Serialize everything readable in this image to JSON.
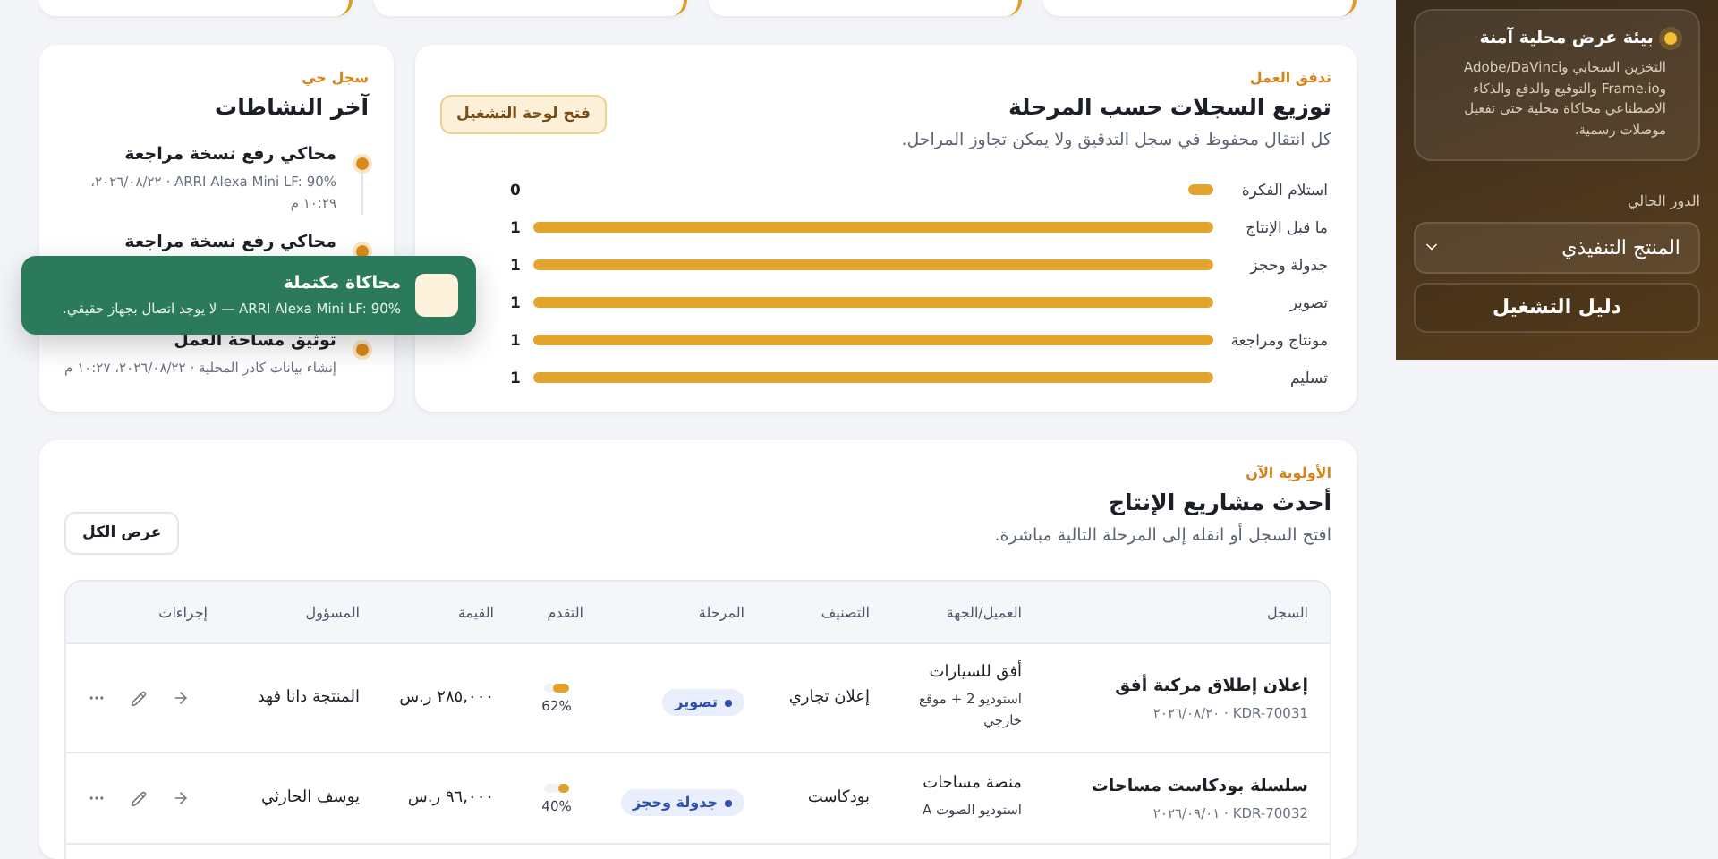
{
  "sidebar": {
    "notice": {
      "title": "بيئة عرض محلية آمنة",
      "text": "التخزين السحابي وAdobe/DaVinci وFrame.io والتوقيع والدفع والذكاء الاصطناعي محاكاة محلية حتى تفعيل موصلات رسمية."
    },
    "role_label": "الدور الحالي",
    "role_select": {
      "value": "المنتج التنفيذي"
    },
    "guide_button": "دليل التشغيل"
  },
  "workflow": {
    "eyebrow": "تدفق العمل",
    "title": "توزيع السجلات حسب المرحلة",
    "subtitle": "كل انتقال محفوظ في سجل التدقيق ولا يمكن تجاوز المراحل.",
    "button": "فتح لوحة التشغيل",
    "chart_data": {
      "type": "bar",
      "orientation": "horizontal",
      "categories": [
        "استلام الفكرة",
        "ما قبل الإنتاج",
        "جدولة وحجز",
        "تصوير",
        "مونتاج ومراجعة",
        "تسليم"
      ],
      "values": [
        0,
        1,
        1,
        1,
        1,
        1
      ],
      "data_labels": true
    }
  },
  "activity": {
    "eyebrow": "سجل حي",
    "title": "آخر النشاطات",
    "items": [
      {
        "title": "محاكي رفع نسخة مراجعة",
        "meta": "ARRI Alexa Mini LF: 90% · ٢٠٢٦/٠٨/٢٢، ١٠:٢٩ م"
      },
      {
        "title": "محاكي رفع نسخة مراجعة"
      },
      {
        "title": "توثيق مساحة العمل",
        "meta": "إنشاء بيانات كادر المحلية · ٢٠٢٦/٠٨/٢٢، ١٠:٢٧ م"
      }
    ]
  },
  "toast": {
    "title": "محاكاة مكتملة",
    "text": "ARRI Alexa Mini LF: 90% — لا يوجد اتصال بجهاز حقيقي."
  },
  "projects": {
    "eyebrow": "الأولوية الآن",
    "title": "أحدث مشاريع الإنتاج",
    "subtitle": "افتح السجل أو انقله إلى المرحلة التالية مباشرة.",
    "button": "عرض الكل",
    "columns": [
      "السجل",
      "العميل/الجهة",
      "التصنيف",
      "المرحلة",
      "التقدم",
      "القيمة",
      "المسؤول",
      "إجراءات"
    ],
    "rows": [
      {
        "title": "إعلان إطلاق مركبة أفق",
        "meta": "KDR-70031 · ٢٠٢٦/٠٨/٢٠",
        "client": "أفق للسيارات",
        "location": "استوديو 2 + موقع خارجي",
        "category": "إعلان تجاري",
        "stage": "تصوير",
        "level": 0.62,
        "progress": "62%",
        "value": "٢٨٥,٠٠٠ ر.س",
        "owner": "المنتجة دانا فهد"
      },
      {
        "title": "سلسلة بودكاست مساحات",
        "meta": "KDR-70032 · ٢٠٢٦/٠٩/٠١",
        "client": "منصة مساحات",
        "location": "استوديو الصوت A",
        "category": "بودكاست",
        "stage": "جدولة وحجز",
        "level": 0.4,
        "progress": "40%",
        "value": "٩٦,٠٠٠ ر.س",
        "owner": "يوسف الحارثي"
      }
    ]
  }
}
